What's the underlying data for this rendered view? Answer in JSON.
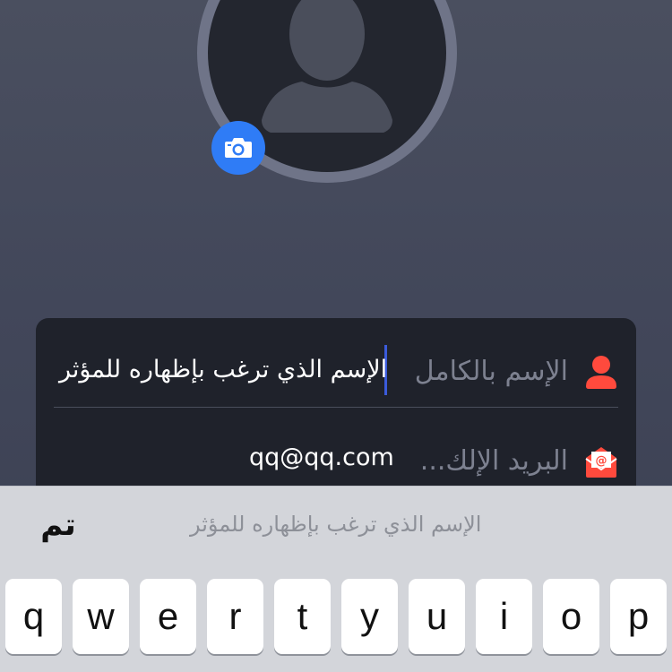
{
  "avatar": {
    "icon": "user-silhouette-icon",
    "camera_icon": "camera-icon",
    "ring_color": "#6f7488",
    "camera_color": "#2f7cf6"
  },
  "form": {
    "full_name": {
      "icon": "user-icon",
      "label": "الإسم بالكامل",
      "value": "الإسم الذي ترغب بإظهاره للمؤثر"
    },
    "email": {
      "icon": "email-icon",
      "label": "البريد الإلك...",
      "value": "qq@qq.com"
    },
    "icon_color": "#ff4a3d",
    "caret_color": "#3b5bdb"
  },
  "suggestion_bar": {
    "done_label": "تم",
    "suggestion": "الإسم الذي ترغب بإظهاره للمؤثر"
  },
  "keyboard": {
    "keys": [
      "q",
      "w",
      "e",
      "r",
      "t",
      "y",
      "u",
      "i",
      "o",
      "p"
    ]
  }
}
